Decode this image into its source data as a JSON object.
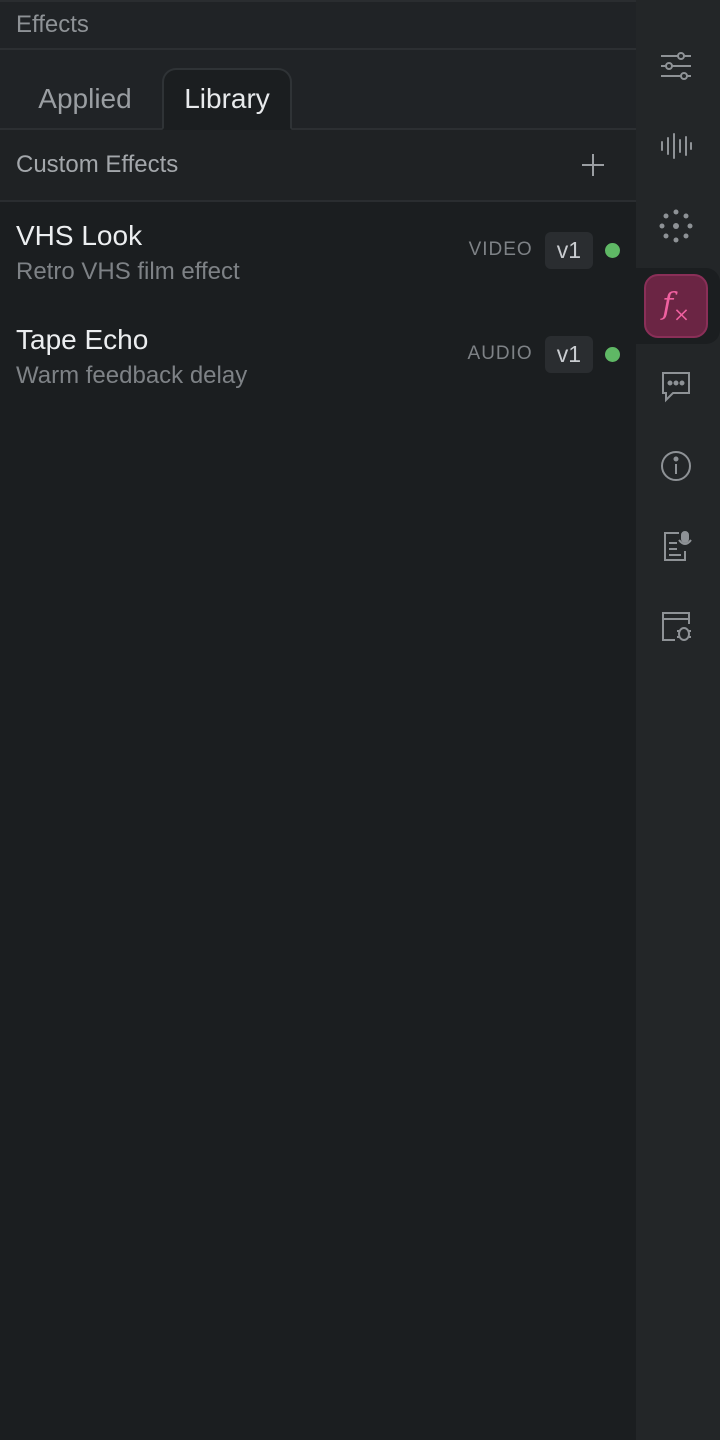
{
  "panel": {
    "title": "Effects"
  },
  "tabs": [
    {
      "label": "Applied",
      "active": false
    },
    {
      "label": "Library",
      "active": true
    }
  ],
  "section": {
    "title": "Custom Effects",
    "add_icon": "plus-icon"
  },
  "effects": [
    {
      "name": "VHS Look",
      "description": "Retro VHS film effect",
      "type": "VIDEO",
      "version": "v1",
      "status_color": "#5fb865"
    },
    {
      "name": "Tape Echo",
      "description": "Warm feedback delay",
      "type": "AUDIO",
      "version": "v1",
      "status_color": "#5fb865"
    }
  ],
  "sidebar": {
    "items": [
      {
        "icon": "sliders-icon"
      },
      {
        "icon": "audio-waveform-icon"
      },
      {
        "icon": "sparkle-dots-icon"
      },
      {
        "icon": "fx-icon",
        "active": true,
        "accent": "#f060a0"
      },
      {
        "icon": "comment-icon"
      },
      {
        "icon": "info-icon"
      },
      {
        "icon": "document-mic-icon"
      },
      {
        "icon": "debug-window-icon"
      }
    ]
  }
}
